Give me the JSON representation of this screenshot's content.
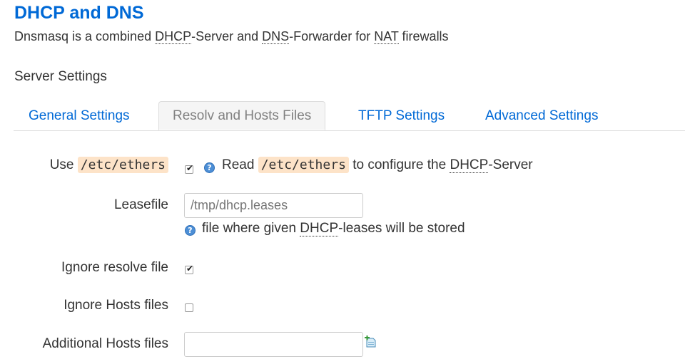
{
  "header": {
    "title": "DHCP and DNS",
    "description": {
      "p1": "Dnsmasq is a combined ",
      "abbr1": "DHCP",
      "p2": "-Server and ",
      "abbr2": "DNS",
      "p3": "-Forwarder for ",
      "abbr3": "NAT",
      "p4": " firewalls"
    }
  },
  "section_title": "Server Settings",
  "tabs": [
    {
      "label": "General Settings",
      "active": false
    },
    {
      "label": "Resolv and Hosts Files",
      "active": true
    },
    {
      "label": "TFTP Settings",
      "active": false
    },
    {
      "label": "Advanced Settings",
      "active": false
    }
  ],
  "fields": {
    "use_ethers": {
      "label_prefix": "Use ",
      "label_code": "/etc/ethers",
      "checked": true,
      "help_prefix": "Read ",
      "help_code": "/etc/ethers",
      "help_mid": " to configure the ",
      "help_abbr": "DHCP",
      "help_suffix": "-Server"
    },
    "leasefile": {
      "label": "Leasefile",
      "placeholder": "/tmp/dhcp.leases",
      "help_prefix": "file where given ",
      "help_abbr": "DHCP",
      "help_suffix": "-leases will be stored"
    },
    "ignore_resolve": {
      "label": "Ignore resolve file",
      "checked": true
    },
    "ignore_hosts": {
      "label": "Ignore Hosts files",
      "checked": false
    },
    "additional_hosts": {
      "label": "Additional Hosts files",
      "value": ""
    }
  },
  "icons": {
    "help": "help-icon",
    "add": "add-entry-icon"
  },
  "colors": {
    "link": "#0069d6",
    "code_bg": "#fde3c8",
    "help_icon": "#4d8fd6"
  }
}
